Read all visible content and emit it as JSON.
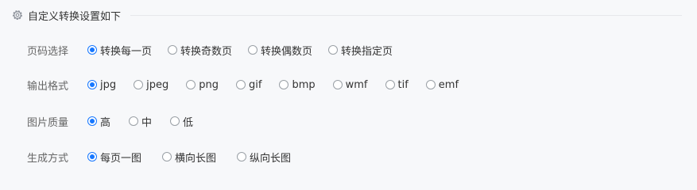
{
  "header": {
    "title": "自定义转换设置如下",
    "icon": "gear-icon"
  },
  "rows": [
    {
      "label": "页码选择",
      "options": [
        "转换每一页",
        "转换奇数页",
        "转换偶数页",
        "转换指定页"
      ],
      "selected": "转换每一页"
    },
    {
      "label": "输出格式",
      "options": [
        "jpg",
        "jpeg",
        "png",
        "gif",
        "bmp",
        "wmf",
        "tif",
        "emf"
      ],
      "selected": "jpg"
    },
    {
      "label": "图片质量",
      "options": [
        "高",
        "中",
        "低"
      ],
      "selected": "高"
    },
    {
      "label": "生成方式",
      "options": [
        "每页一图",
        "横向长图",
        "纵向长图"
      ],
      "selected": "每页一图"
    }
  ],
  "colors": {
    "accent": "#1677ff",
    "background": "#f7f8fa",
    "divider": "#e6e8eb"
  }
}
